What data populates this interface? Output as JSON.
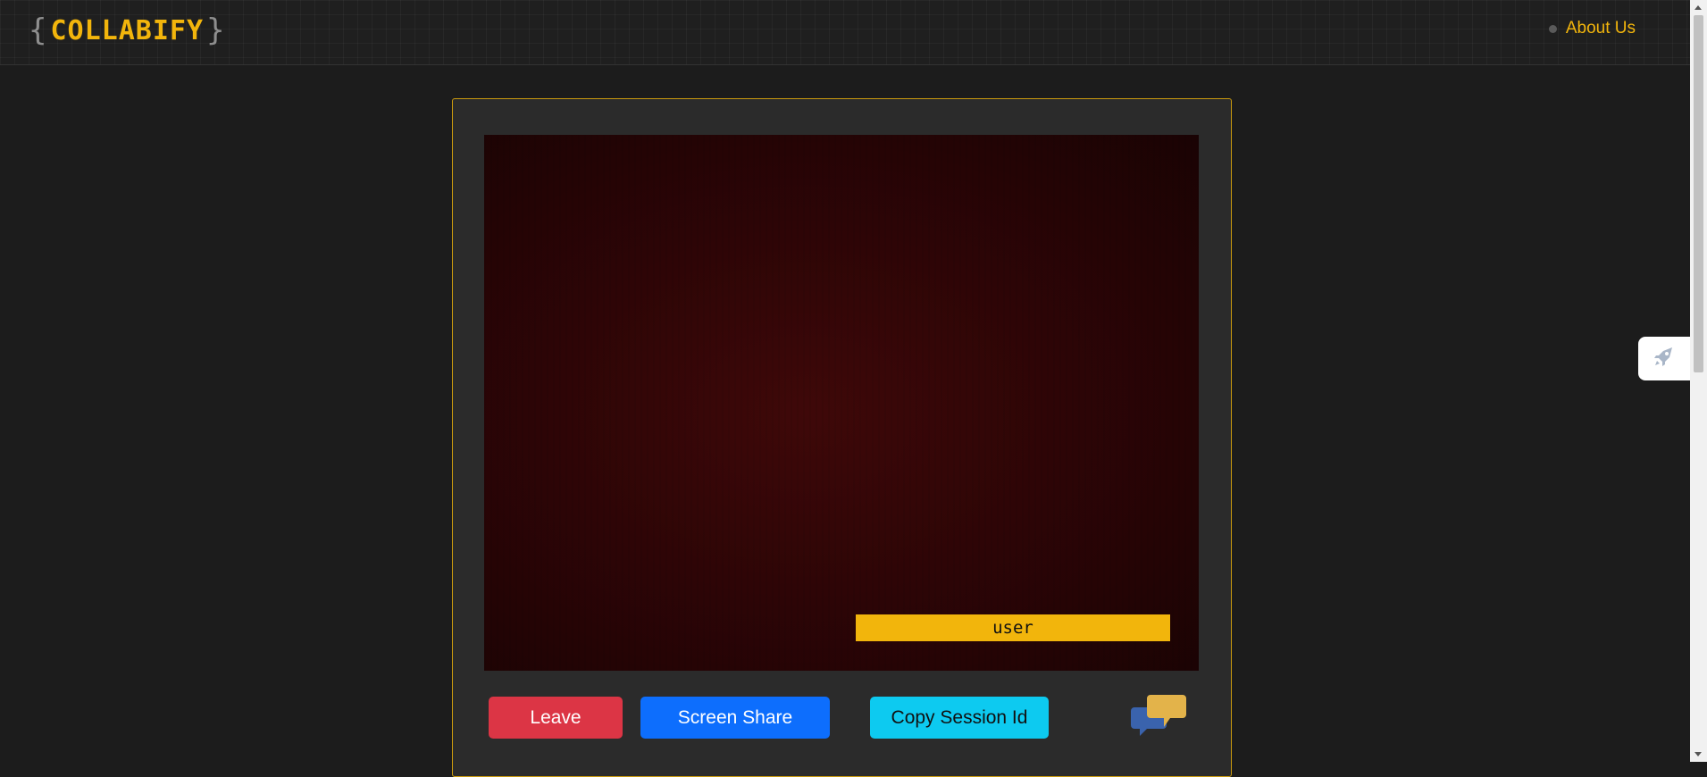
{
  "header": {
    "logo": {
      "open_brace": "{",
      "name": "COLLABIFY",
      "close_brace": "}"
    },
    "nav": {
      "about_label": "About Us"
    }
  },
  "session": {
    "participant_name": "user"
  },
  "controls": {
    "leave_label": "Leave",
    "screen_share_label": "Screen Share",
    "copy_session_label": "Copy Session Id",
    "chat_icon": "chat-bubbles-icon"
  },
  "side_tab": {
    "icon": "rocket-icon"
  },
  "colors": {
    "accent": "#f2b50c",
    "background": "#1c1c1c",
    "panel": "#2b2b2b",
    "leave": "#dc3545",
    "screen_share": "#0d6efd",
    "copy_session": "#0dcaf0"
  }
}
